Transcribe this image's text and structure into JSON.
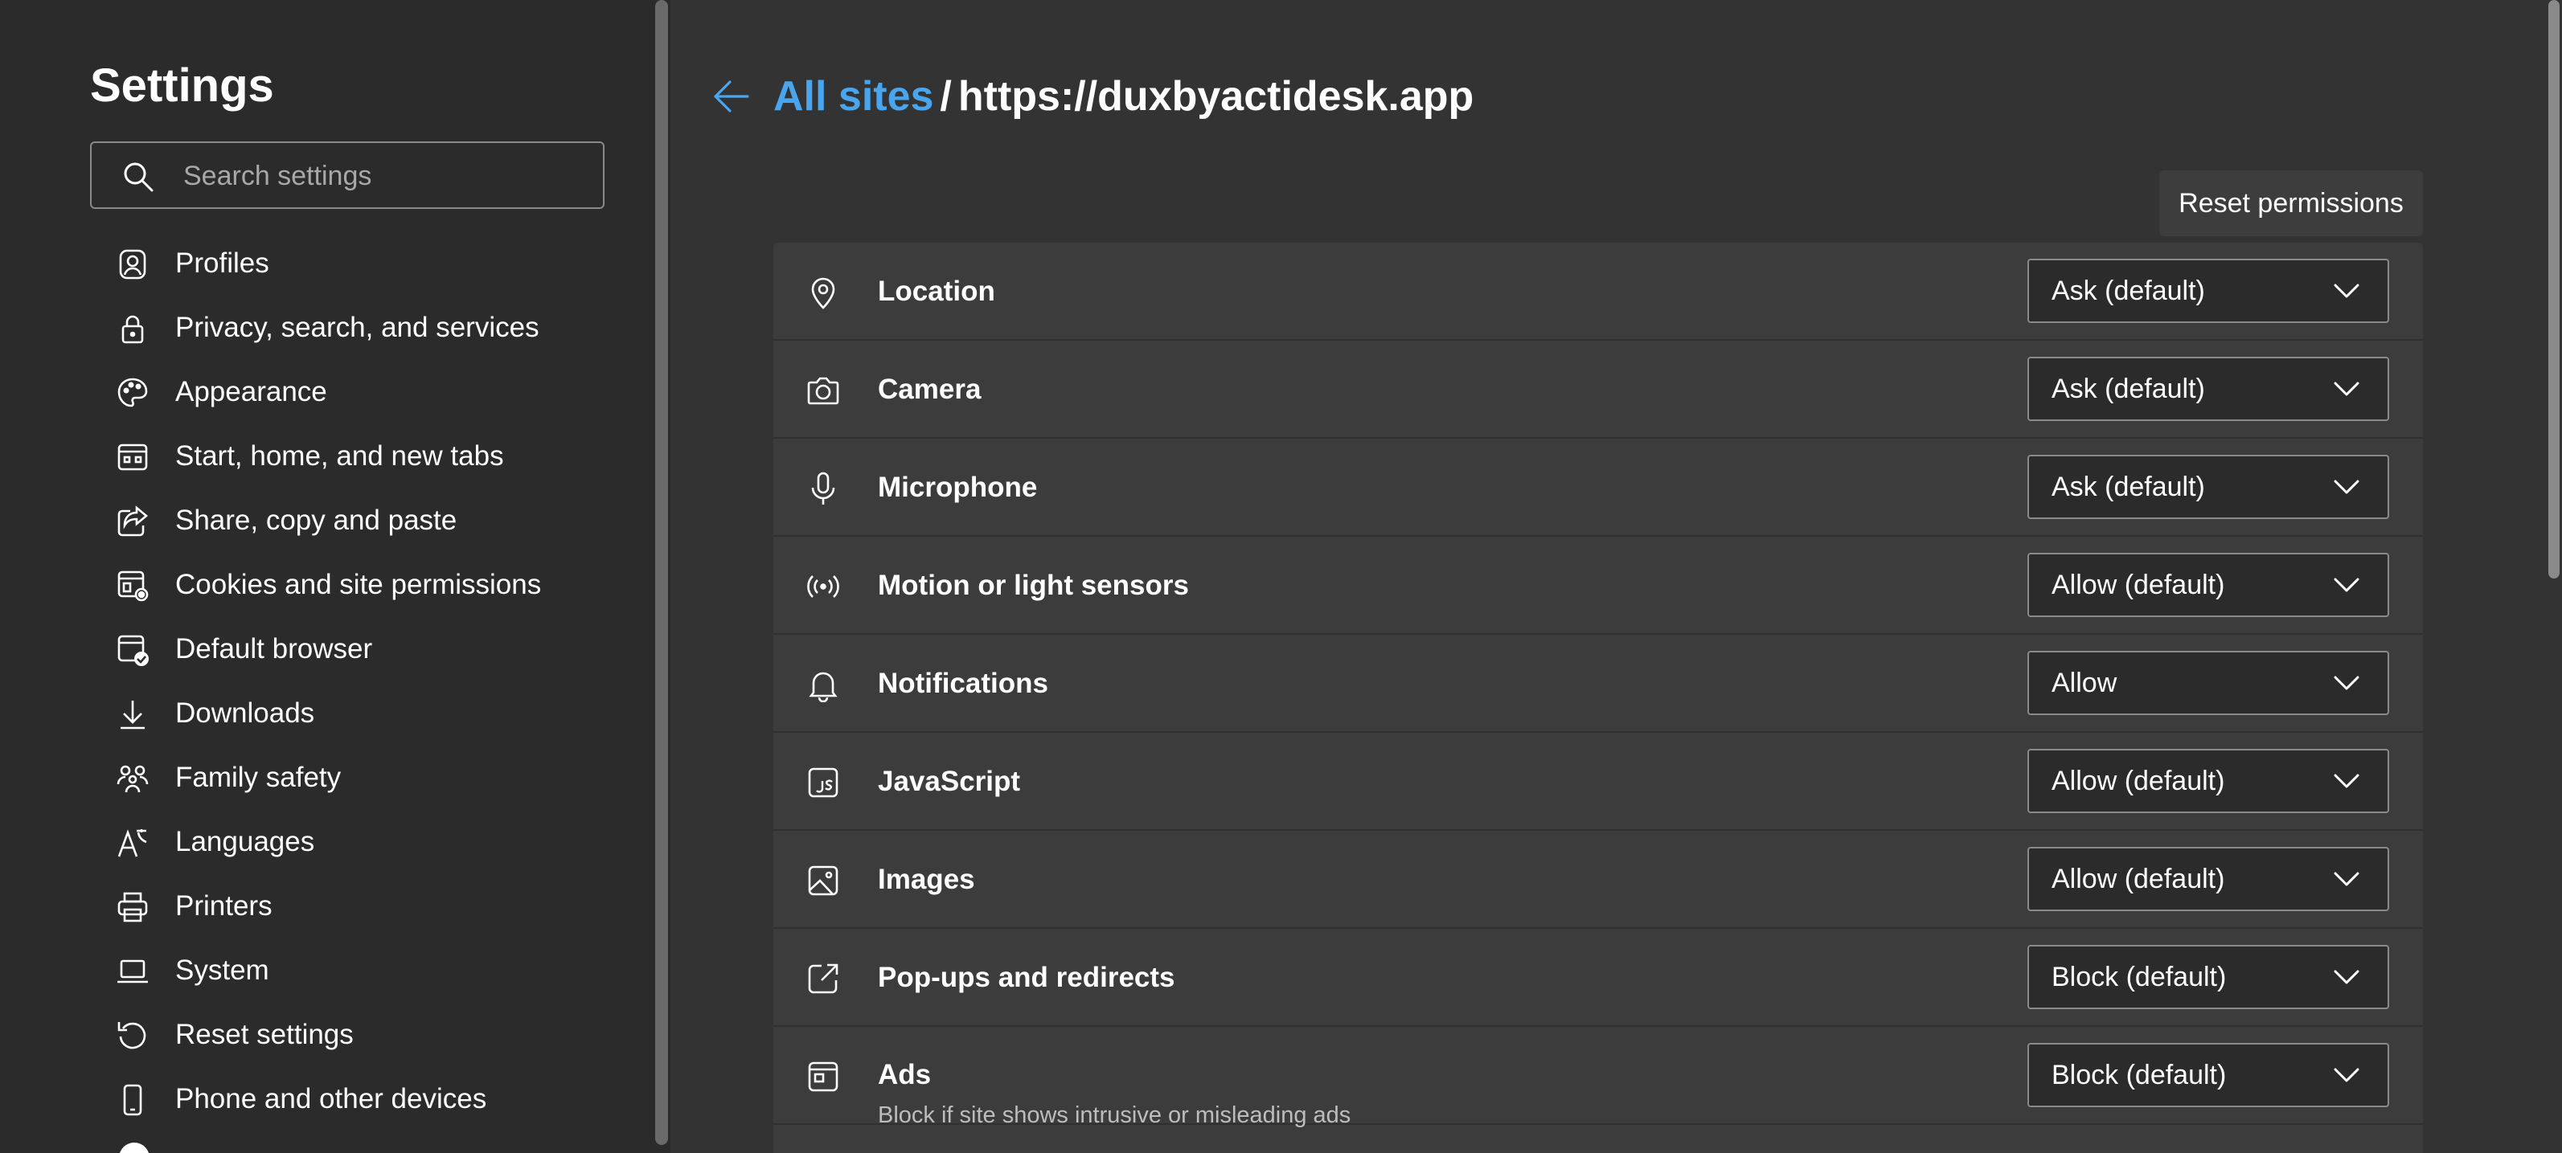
{
  "sidebar": {
    "title": "Settings",
    "search": {
      "placeholder": "Search settings",
      "value": ""
    },
    "items": [
      {
        "label": "Profiles",
        "icon": "profile-icon"
      },
      {
        "label": "Privacy, search, and services",
        "icon": "lock-icon"
      },
      {
        "label": "Appearance",
        "icon": "palette-icon"
      },
      {
        "label": "Start, home, and new tabs",
        "icon": "home-tabs-icon"
      },
      {
        "label": "Share, copy and paste",
        "icon": "share-icon"
      },
      {
        "label": "Cookies and site permissions",
        "icon": "cookies-permissions-icon"
      },
      {
        "label": "Default browser",
        "icon": "default-browser-icon"
      },
      {
        "label": "Downloads",
        "icon": "download-icon"
      },
      {
        "label": "Family safety",
        "icon": "family-icon"
      },
      {
        "label": "Languages",
        "icon": "languages-icon"
      },
      {
        "label": "Printers",
        "icon": "printer-icon"
      },
      {
        "label": "System",
        "icon": "laptop-icon"
      },
      {
        "label": "Reset settings",
        "icon": "reset-icon"
      },
      {
        "label": "Phone and other devices",
        "icon": "phone-icon"
      }
    ]
  },
  "header": {
    "back_icon": "back-arrow-icon",
    "breadcrumb_link": "All sites",
    "breadcrumb_separator": "/",
    "site_url": "https://duxbyactidesk.app"
  },
  "actions": {
    "reset_label": "Reset permissions"
  },
  "permissions": [
    {
      "label": "Location",
      "value": "Ask (default)",
      "icon": "location-icon"
    },
    {
      "label": "Camera",
      "value": "Ask (default)",
      "icon": "camera-icon"
    },
    {
      "label": "Microphone",
      "value": "Ask (default)",
      "icon": "microphone-icon"
    },
    {
      "label": "Motion or light sensors",
      "value": "Allow (default)",
      "icon": "sensors-icon"
    },
    {
      "label": "Notifications",
      "value": "Allow",
      "icon": "bell-icon"
    },
    {
      "label": "JavaScript",
      "value": "Allow (default)",
      "icon": "javascript-icon"
    },
    {
      "label": "Images",
      "value": "Allow (default)",
      "icon": "image-icon"
    },
    {
      "label": "Pop-ups and redirects",
      "value": "Block (default)",
      "icon": "popup-icon"
    },
    {
      "label": "Ads",
      "value": "Block (default)",
      "icon": "ads-icon",
      "description": "Block if site shows intrusive or misleading ads"
    }
  ],
  "colors": {
    "accent": "#4aa5ef",
    "sidebar_bg": "#2b2b2b",
    "main_bg": "#333333",
    "panel_bg": "#3c3c3c"
  }
}
